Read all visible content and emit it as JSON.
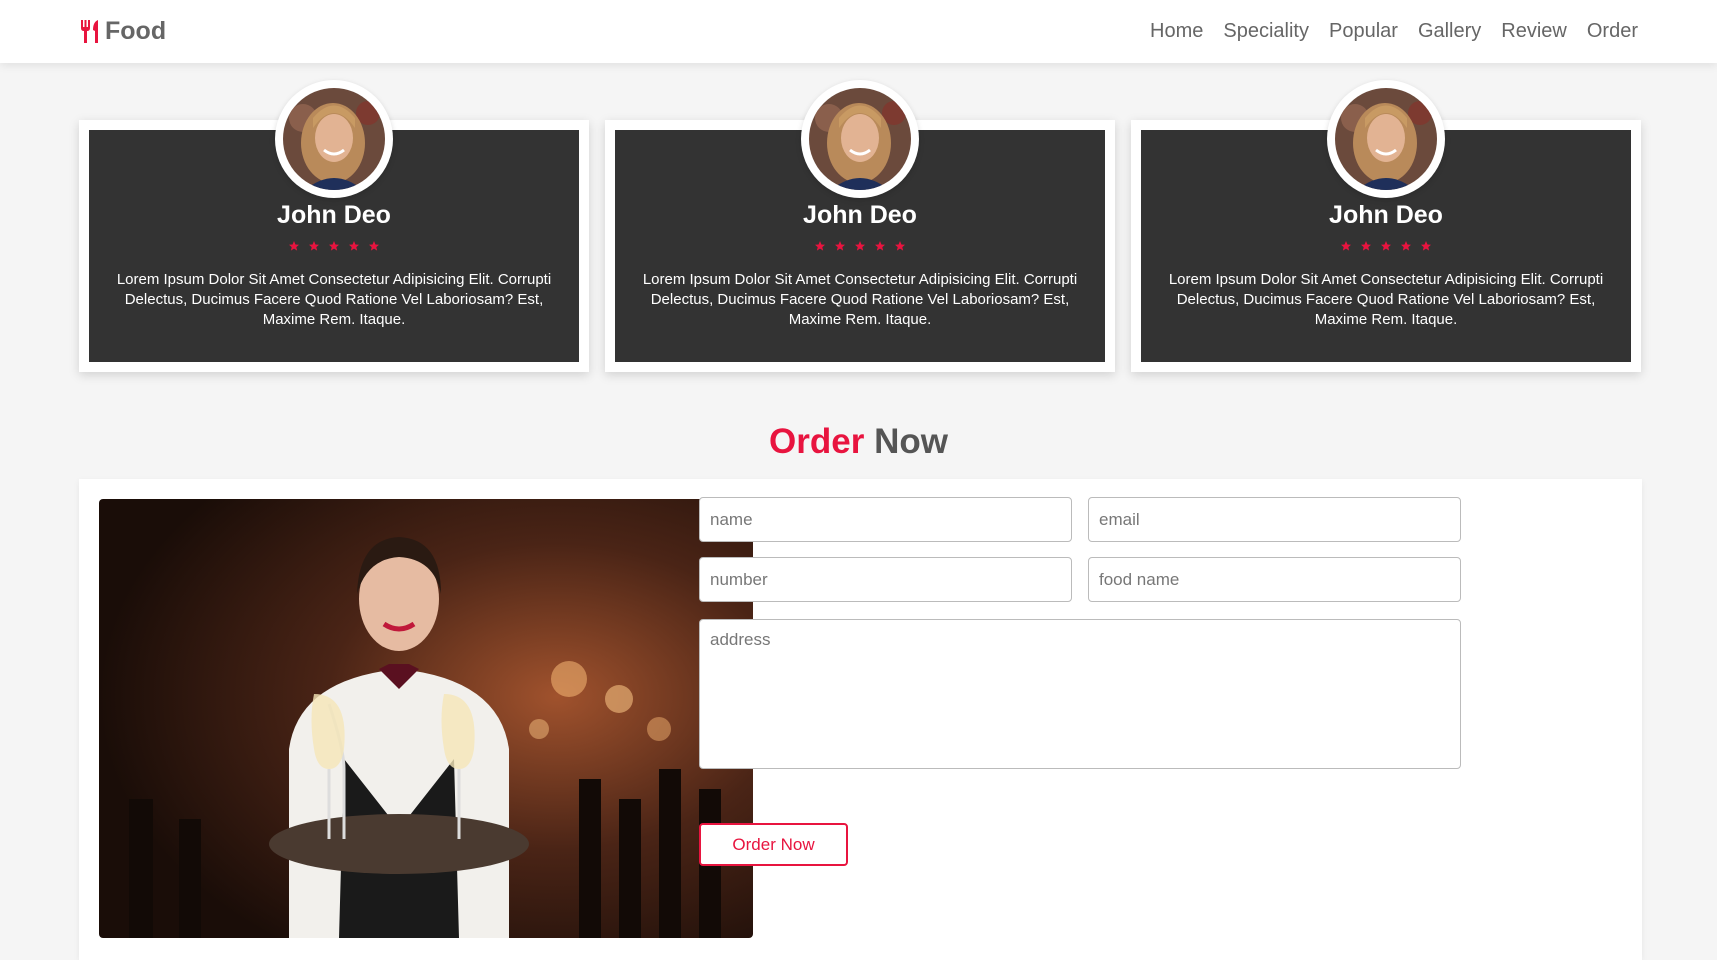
{
  "header": {
    "logo_text": "Food",
    "nav": [
      "Home",
      "Speciality",
      "Popular",
      "Gallery",
      "Review",
      "Order"
    ]
  },
  "reviews": [
    {
      "name": "John Deo",
      "rating": 5,
      "text": "Lorem Ipsum Dolor Sit Amet Consectetur Adipisicing Elit. Corrupti Delectus, Ducimus Facere Quod Ratione Vel Laboriosam? Est, Maxime Rem. Itaque."
    },
    {
      "name": "John Deo",
      "rating": 5,
      "text": "Lorem Ipsum Dolor Sit Amet Consectetur Adipisicing Elit. Corrupti Delectus, Ducimus Facere Quod Ratione Vel Laboriosam? Est, Maxime Rem. Itaque."
    },
    {
      "name": "John Deo",
      "rating": 5,
      "text": "Lorem Ipsum Dolor Sit Amet Consectetur Adipisicing Elit. Corrupti Delectus, Ducimus Facere Quod Ratione Vel Laboriosam? Est, Maxime Rem. Itaque."
    }
  ],
  "order_heading": {
    "accent": "Order",
    "rest": "Now"
  },
  "order_form": {
    "name_placeholder": "name",
    "email_placeholder": "email",
    "number_placeholder": "number",
    "food_name_placeholder": "food name",
    "address_placeholder": "address",
    "submit_label": "Order Now"
  },
  "colors": {
    "accent": "#e8143f",
    "card_dark": "#333333"
  }
}
